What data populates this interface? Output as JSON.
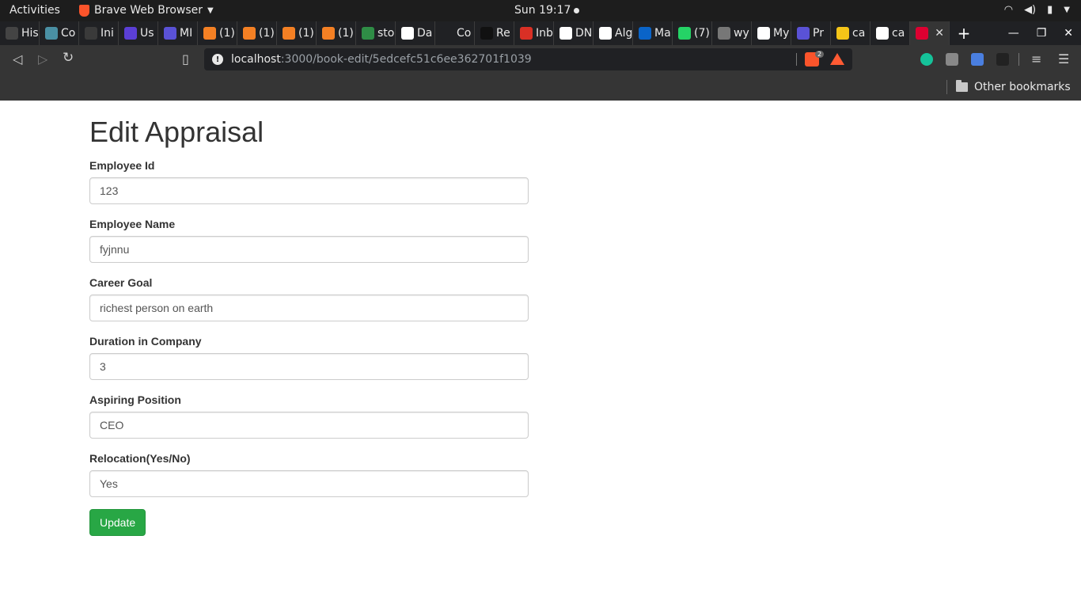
{
  "system": {
    "activities": "Activities",
    "app_name": "Brave Web Browser",
    "clock": "Sun 19:17"
  },
  "tabs": [
    {
      "label": "His",
      "icon": "history-icon",
      "color": "#444444"
    },
    {
      "label": "Co",
      "icon": "doc-icon",
      "color": "#4a90a4"
    },
    {
      "label": "Ini",
      "icon": "td-icon",
      "color": "#3a3a3a"
    },
    {
      "label": "Us",
      "icon": "mail-icon",
      "color": "#5b3fd6"
    },
    {
      "label": "MI",
      "icon": "docs-icon",
      "color": "#5a52d6"
    },
    {
      "label": "(1)",
      "icon": "stackoverflow-icon",
      "color": "#f48024"
    },
    {
      "label": "(1)",
      "icon": "stackoverflow-icon",
      "color": "#f48024"
    },
    {
      "label": "(1)",
      "icon": "stackoverflow-icon",
      "color": "#f48024"
    },
    {
      "label": "(1)",
      "icon": "stackoverflow-icon",
      "color": "#f48024"
    },
    {
      "label": "sto",
      "icon": "geeksforgeeks-icon",
      "color": "#2f8d46"
    },
    {
      "label": "Da",
      "icon": "page-icon",
      "color": "#ffffff"
    },
    {
      "label": "Co",
      "icon": "page-icon",
      "color": "#202124"
    },
    {
      "label": "Re",
      "icon": "circle-icon",
      "color": "#111111"
    },
    {
      "label": "Inb",
      "icon": "gmail-icon",
      "color": "#d93025"
    },
    {
      "label": "DN",
      "icon": "github-icon",
      "color": "#ffffff"
    },
    {
      "label": "Alg",
      "icon": "github-icon",
      "color": "#ffffff"
    },
    {
      "label": "Ma",
      "icon": "outlook-icon",
      "color": "#0a64c8"
    },
    {
      "label": "(7)",
      "icon": "whatsapp-icon",
      "color": "#25d366"
    },
    {
      "label": "wy",
      "icon": "globe-icon",
      "color": "#777777"
    },
    {
      "label": "My",
      "icon": "github-icon",
      "color": "#ffffff"
    },
    {
      "label": "Pr",
      "icon": "docs-icon",
      "color": "#5a52d6"
    },
    {
      "label": "ca",
      "icon": "smiley-icon",
      "color": "#f5c518"
    },
    {
      "label": "ca",
      "icon": "github-icon",
      "color": "#ffffff"
    },
    {
      "label": "",
      "icon": "angular-icon",
      "color": "#dd0031",
      "active": true
    }
  ],
  "address_bar": {
    "host": "localhost",
    "path": ":3000/book-edit/5edcefc51c6ee362701f1039",
    "shield_count": "2"
  },
  "bookmarks": {
    "other": "Other bookmarks"
  },
  "form": {
    "title": "Edit Appraisal",
    "fields": [
      {
        "label": "Employee Id",
        "value": "123"
      },
      {
        "label": "Employee Name",
        "value": "fyjnnu"
      },
      {
        "label": "Career Goal",
        "value": "richest person on earth"
      },
      {
        "label": "Duration in Company",
        "value": "3"
      },
      {
        "label": "Aspiring Position",
        "value": "CEO"
      },
      {
        "label": "Relocation(Yes/No)",
        "value": "Yes"
      }
    ],
    "submit_label": "Update",
    "submit_color": "#28a745"
  }
}
